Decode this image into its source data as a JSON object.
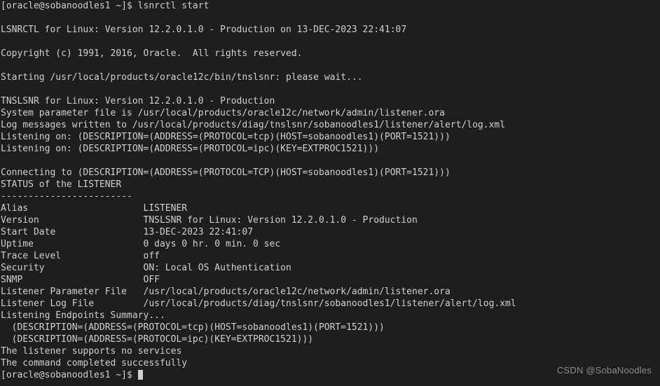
{
  "terminal": {
    "background_color": "#1e1e1e",
    "foreground_color": "#d0d0d0",
    "cursor_color": "#cfcfcf",
    "prompt": "[oracle@sobanoodles1 ~]$",
    "command": "lsnrctl start",
    "lines": [
      "[oracle@sobanoodles1 ~]$ lsnrctl start",
      "",
      "LSNRCTL for Linux: Version 12.2.0.1.0 - Production on 13-DEC-2023 22:41:07",
      "",
      "Copyright (c) 1991, 2016, Oracle.  All rights reserved.",
      "",
      "Starting /usr/local/products/oracle12c/bin/tnslsnr: please wait...",
      "",
      "TNSLSNR for Linux: Version 12.2.0.1.0 - Production",
      "System parameter file is /usr/local/products/oracle12c/network/admin/listener.ora",
      "Log messages written to /usr/local/products/diag/tnslsnr/sobanoodles1/listener/alert/log.xml",
      "Listening on: (DESCRIPTION=(ADDRESS=(PROTOCOL=tcp)(HOST=sobanoodles1)(PORT=1521)))",
      "Listening on: (DESCRIPTION=(ADDRESS=(PROTOCOL=ipc)(KEY=EXTPROC1521)))",
      "",
      "Connecting to (DESCRIPTION=(ADDRESS=(PROTOCOL=TCP)(HOST=sobanoodles1)(PORT=1521)))",
      "STATUS of the LISTENER",
      "------------------------",
      "Alias                     LISTENER",
      "Version                   TNSLSNR for Linux: Version 12.2.0.1.0 - Production",
      "Start Date                13-DEC-2023 22:41:07",
      "Uptime                    0 days 0 hr. 0 min. 0 sec",
      "Trace Level               off",
      "Security                  ON: Local OS Authentication",
      "SNMP                      OFF",
      "Listener Parameter File   /usr/local/products/oracle12c/network/admin/listener.ora",
      "Listener Log File         /usr/local/products/diag/tnslsnr/sobanoodles1/listener/alert/log.xml",
      "Listening Endpoints Summary...",
      "  (DESCRIPTION=(ADDRESS=(PROTOCOL=tcp)(HOST=sobanoodles1)(PORT=1521)))",
      "  (DESCRIPTION=(ADDRESS=(PROTOCOL=ipc)(KEY=EXTPROC1521)))",
      "The listener supports no services",
      "The command completed successfully"
    ],
    "final_prompt": "[oracle@sobanoodles1 ~]$ ",
    "status_table": {
      "separator": "------------------------",
      "rows": [
        {
          "label": "Alias",
          "value": "LISTENER"
        },
        {
          "label": "Version",
          "value": "TNSLSNR for Linux: Version 12.2.0.1.0 - Production"
        },
        {
          "label": "Start Date",
          "value": "13-DEC-2023 22:41:07"
        },
        {
          "label": "Uptime",
          "value": "0 days 0 hr. 0 min. 0 sec"
        },
        {
          "label": "Trace Level",
          "value": "off"
        },
        {
          "label": "Security",
          "value": "ON: Local OS Authentication"
        },
        {
          "label": "SNMP",
          "value": "OFF"
        },
        {
          "label": "Listener Parameter File",
          "value": "/usr/local/products/oracle12c/network/admin/listener.ora"
        },
        {
          "label": "Listener Log File",
          "value": "/usr/local/products/diag/tnslsnr/sobanoodles1/listener/alert/log.xml"
        }
      ]
    }
  },
  "watermark": {
    "text": "CSDN @SobaNoodles",
    "color": "#8c8c8c"
  }
}
